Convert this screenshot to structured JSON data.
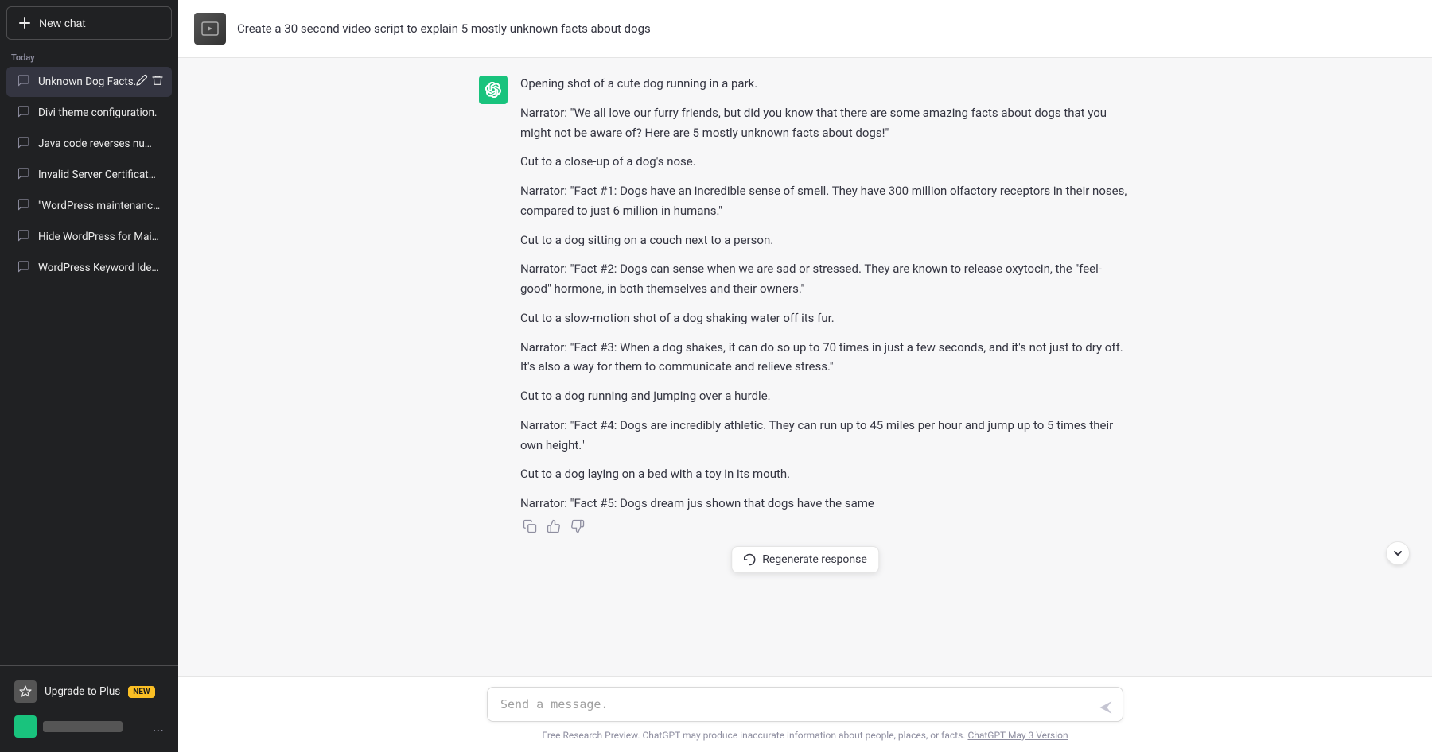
{
  "sidebar": {
    "new_chat_label": "New chat",
    "section_today": "Today",
    "chat_items": [
      {
        "id": "unknown-dog-facts",
        "label": "Unknown Dog Facts.",
        "active": true
      },
      {
        "id": "divi-theme",
        "label": "Divi theme configuration."
      },
      {
        "id": "java-code",
        "label": "Java code reverses numbers."
      },
      {
        "id": "invalid-cert",
        "label": "Invalid Server Certificate Error"
      },
      {
        "id": "wordpress-maintenance",
        "label": "\"WordPress maintenance plug"
      },
      {
        "id": "hide-wordpress",
        "label": "Hide WordPress for Maintenan"
      },
      {
        "id": "wordpress-keyword",
        "label": "WordPress Keyword Ideas."
      }
    ],
    "upgrade_label": "Upgrade to Plus",
    "new_badge": "NEW",
    "user_label": "blurred user",
    "more_options": "..."
  },
  "header": {
    "prompt_text": "Create a 30 second video script to explain 5 mostly unknown facts about dogs"
  },
  "message": {
    "first_line": "Opening shot of a cute dog running in a park.",
    "paragraphs": [
      "Narrator: \"We all love our furry friends, but did you know that there are some amazing facts about dogs that you might not be aware of? Here are 5 mostly unknown facts about dogs!\"",
      "Cut to a close-up of a dog's nose.",
      "Narrator: \"Fact #1: Dogs have an incredible sense of smell. They have 300 million olfactory receptors in their noses, compared to just 6 million in humans.\"",
      "Cut to a dog sitting on a couch next to a person.",
      "Narrator: \"Fact #2: Dogs can sense when we are sad or stressed. They are known to release oxytocin, the \"feel-good\" hormone, in both themselves and their owners.\"",
      "Cut to a slow-motion shot of a dog shaking water off its fur.",
      "Narrator: \"Fact #3: When a dog shakes, it can do so up to 70 times in just a few seconds, and it's not just to dry off. It's also a way for them to communicate and relieve stress.\"",
      "Cut to a dog running and jumping over a hurdle.",
      "Narrator: \"Fact #4: Dogs are incredibly athletic. They can run up to 45 miles per hour and jump up to 5 times their own height.\"",
      "Cut to a dog laying on a bed with a toy in its mouth.",
      "Narrator: \"Fact #5: Dogs dream jus shown that dogs have the same"
    ],
    "copy_label": "Copy",
    "thumbup_label": "Thumbs up",
    "thumbdown_label": "Thumbs down"
  },
  "regenerate_popup": {
    "label": "Regenerate response"
  },
  "input": {
    "placeholder": "Send a message.",
    "send_label": "Send"
  },
  "footer": {
    "text": "Free Research Preview. ChatGPT may produce inaccurate information about people, places, or facts.",
    "link_label": "ChatGPT May 3 Version"
  }
}
